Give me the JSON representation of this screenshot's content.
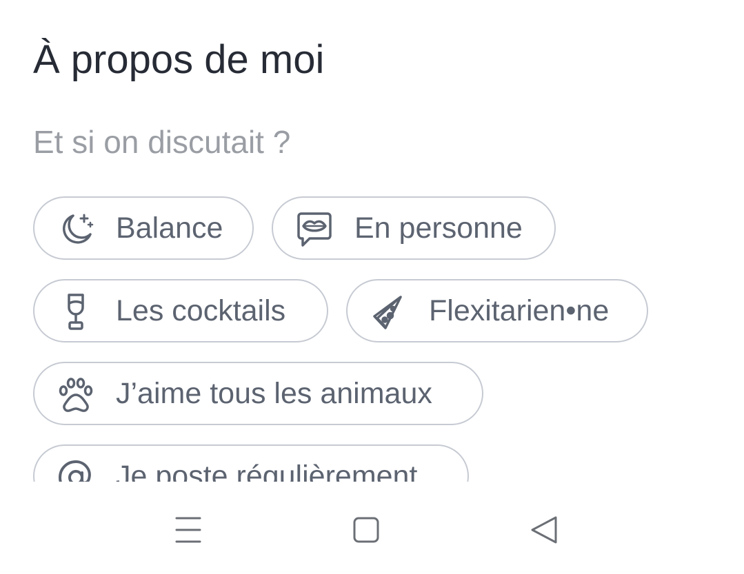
{
  "section": {
    "title": "À propos de moi",
    "subtitle": "Et si on discutait ?"
  },
  "chips": [
    {
      "label": "Balance",
      "icon": "moon-stars-icon"
    },
    {
      "label": "En personne",
      "icon": "lips-speech-bubble-icon"
    },
    {
      "label": "Les cocktails",
      "icon": "wine-glass-icon"
    },
    {
      "label": "Flexitarien•ne",
      "icon": "pizza-slice-icon"
    },
    {
      "label": "J’aime tous les animaux",
      "icon": "paw-icon"
    },
    {
      "label": "Je poste régulièrement",
      "icon": "at-sign-icon"
    }
  ],
  "navbar": {
    "buttons": [
      "menu-icon",
      "home-square-icon",
      "back-triangle-icon"
    ]
  },
  "colors": {
    "title": "#262b35",
    "subtitle": "#9a9ea4",
    "chip_text": "#5c6370",
    "chip_border": "#c6cad2",
    "nav_icon": "#6b6f75"
  }
}
